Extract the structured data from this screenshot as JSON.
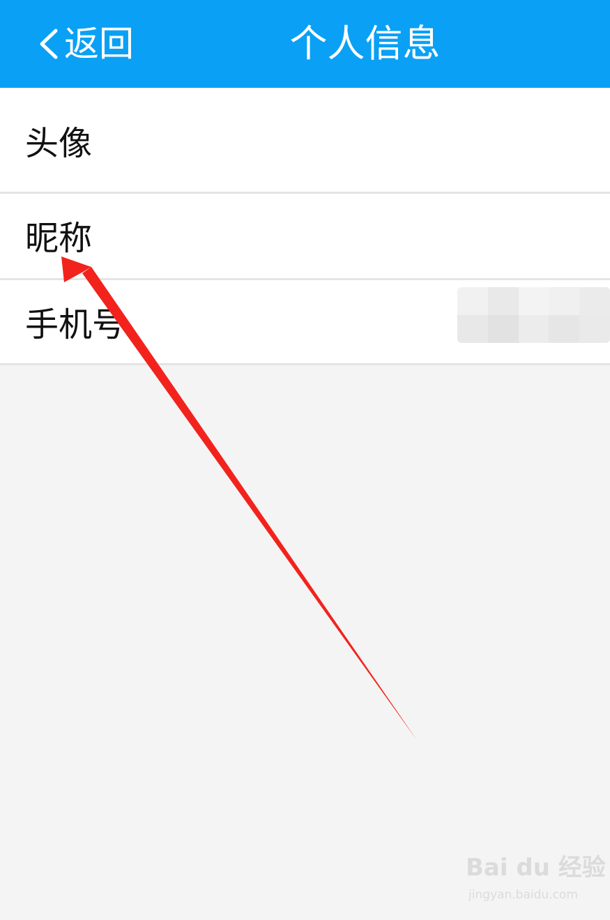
{
  "header": {
    "back_label": "返回",
    "title": "个人信息",
    "background_color": "#0aa0f5",
    "back_icon": "chevron-left-icon"
  },
  "rows": [
    {
      "label": "头像"
    },
    {
      "label": "昵称"
    },
    {
      "label": "手机号",
      "value_obscured": true
    }
  ],
  "annotation": {
    "type": "arrow",
    "color": "#f2231c",
    "target": "昵称"
  },
  "watermark": {
    "brand": "Bai du 经验",
    "url": "jingyan.baidu.com"
  }
}
